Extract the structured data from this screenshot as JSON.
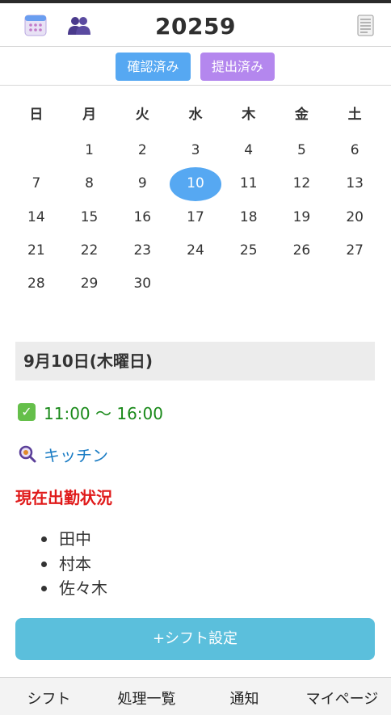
{
  "header": {
    "title": "20259",
    "icons": [
      "calendar-icon",
      "people-icon",
      "document-icon"
    ]
  },
  "status_buttons": {
    "confirmed_label": "確認済み",
    "submitted_label": "提出済み"
  },
  "calendar": {
    "weekdays": [
      "日",
      "月",
      "火",
      "水",
      "木",
      "金",
      "土"
    ],
    "weeks": [
      [
        "",
        "1",
        "2",
        "3",
        "4",
        "5",
        "6"
      ],
      [
        "7",
        "8",
        "9",
        "10",
        "11",
        "12",
        "13"
      ],
      [
        "14",
        "15",
        "16",
        "17",
        "18",
        "19",
        "20"
      ],
      [
        "21",
        "22",
        "23",
        "24",
        "25",
        "26",
        "27"
      ],
      [
        "28",
        "29",
        "30",
        "",
        "",
        "",
        ""
      ]
    ],
    "selected_day": "10"
  },
  "detail": {
    "date_label": "9月10日(木曜日)",
    "time_range": "11:00 〜 16:00",
    "place": "キッチン",
    "attendance_title": "現在出勤状況",
    "staff": [
      "田中",
      "村本",
      "佐々木"
    ]
  },
  "actions": {
    "shift_button_label": "+シフト設定"
  },
  "bottom_nav": {
    "items": [
      "シフト",
      "処理一覧",
      "通知",
      "マイページ"
    ]
  },
  "colors": {
    "accent_blue": "#56a8f2",
    "accent_purple": "#b487ee",
    "shift_button": "#5bbfdc",
    "time_green": "#1a8a1a",
    "place_blue": "#1a7cc4",
    "alert_red": "#e01a1a"
  }
}
